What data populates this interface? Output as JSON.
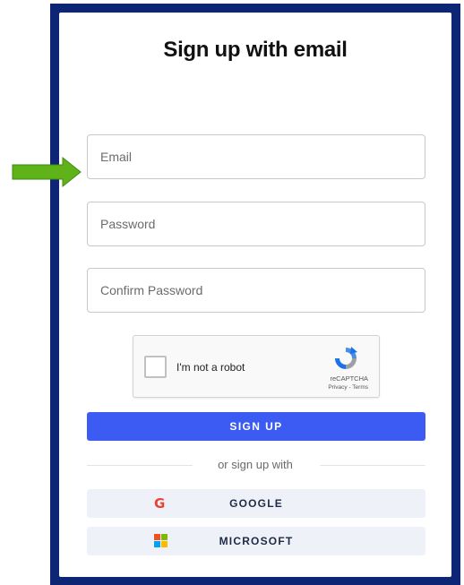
{
  "page": {
    "title": "Sign up with email"
  },
  "form": {
    "email_placeholder": "Email",
    "password_placeholder": "Password",
    "confirm_placeholder": "Confirm Password",
    "email_value": "",
    "password_value": "",
    "confirm_value": ""
  },
  "captcha": {
    "label": "I'm not a robot",
    "brand": "reCAPTCHA",
    "links": "Privacy - Terms",
    "checked": false
  },
  "actions": {
    "signup_label": "SIGN UP",
    "divider_text": "or sign up with",
    "google_label": "GOOGLE",
    "microsoft_label": "MICROSOFT"
  },
  "icons": {
    "arrow": "right-arrow-icon",
    "google": "google-icon",
    "microsoft": "microsoft-icon",
    "recaptcha": "recaptcha-icon"
  },
  "colors": {
    "frame": "#0d2575",
    "primary": "#3b5bf2",
    "arrow": "#5fb319",
    "social_bg": "#eef2f8",
    "ms_red": "#f25022",
    "ms_green": "#7fba00",
    "ms_blue": "#00a4ef",
    "ms_yellow": "#ffb900"
  }
}
